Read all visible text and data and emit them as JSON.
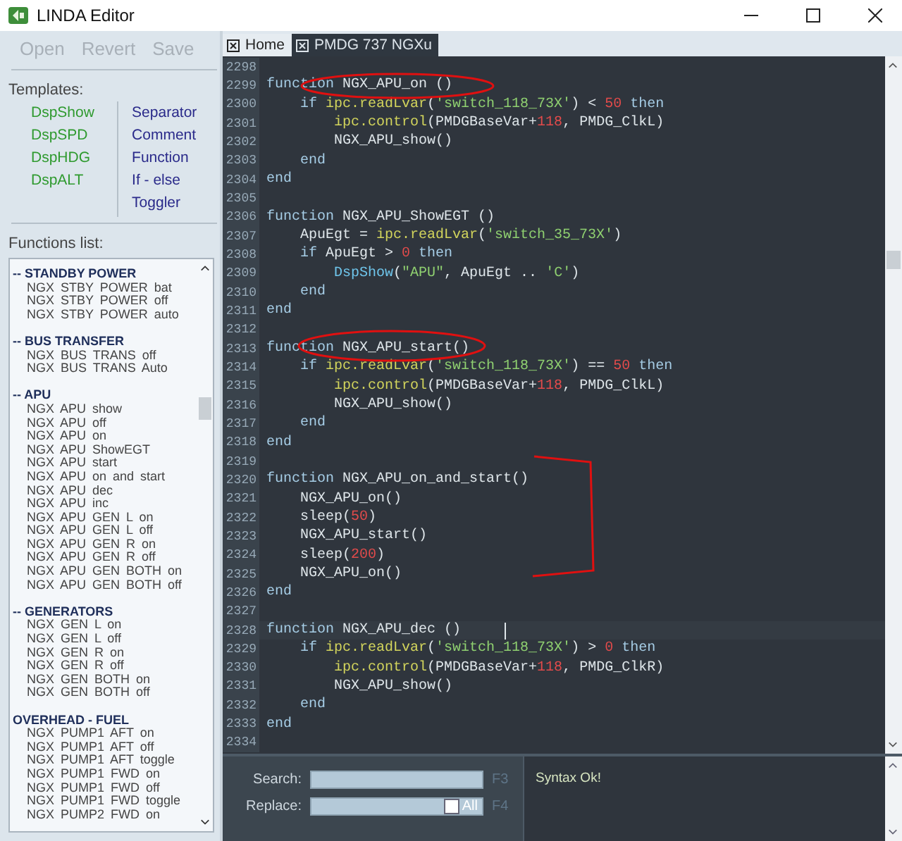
{
  "window": {
    "title": "LINDA Editor"
  },
  "toolbar": [
    {
      "label": "Open",
      "disabled": true
    },
    {
      "label": "Revert",
      "disabled": true
    },
    {
      "label": "Save",
      "disabled": true
    }
  ],
  "templates": {
    "label": "Templates:",
    "columns": [
      {
        "kind": "display",
        "items": [
          "DspShow",
          "DspSPD",
          "DspHDG",
          "DspALT"
        ]
      },
      {
        "kind": "structure",
        "items": [
          "Separator",
          "Comment",
          "Function",
          "If - else",
          "Toggler"
        ]
      }
    ]
  },
  "functions_list": {
    "label": "Functions list:",
    "groups": [
      {
        "title": "-- STANDBY POWER",
        "items": [
          "NGX STBY POWER bat",
          "NGX STBY POWER off",
          "NGX STBY POWER auto"
        ]
      },
      {
        "title": "-- BUS TRANSFER",
        "items": [
          "NGX BUS TRANS off",
          "NGX BUS TRANS Auto"
        ]
      },
      {
        "title": "-- APU",
        "items": [
          "NGX APU show",
          "NGX APU off",
          "NGX APU on",
          "NGX APU ShowEGT",
          "NGX APU start",
          "NGX APU on and start",
          "NGX APU dec",
          "NGX APU inc",
          "NGX APU GEN L on",
          "NGX APU GEN L off",
          "NGX APU GEN R on",
          "NGX APU GEN R off",
          "NGX APU GEN BOTH on",
          "NGX APU GEN BOTH off"
        ]
      },
      {
        "title": "-- GENERATORS",
        "items": [
          "NGX GEN L on",
          "NGX GEN L off",
          "NGX GEN R on",
          "NGX GEN R off",
          "NGX GEN BOTH on",
          "NGX GEN BOTH off"
        ]
      },
      {
        "title": "OVERHEAD - FUEL",
        "items": [
          "NGX PUMP1 AFT on",
          "NGX PUMP1 AFT off",
          "NGX PUMP1 AFT toggle",
          "NGX PUMP1 FWD on",
          "NGX PUMP1 FWD off",
          "NGX PUMP1 FWD toggle",
          "NGX PUMP2 FWD on"
        ]
      }
    ]
  },
  "tabs": [
    {
      "label": "Home",
      "selected": false
    },
    {
      "label": "PMDG 737 NGXu",
      "selected": true
    }
  ],
  "editor": {
    "lines": [
      {
        "number": "2298",
        "current": false
      },
      {
        "number": "2299",
        "current": false,
        "tokens": [
          {
            "kind": "keyword",
            "text": "function"
          },
          {
            "kind": "plain",
            "text": " NGX_APU_on ()"
          }
        ]
      },
      {
        "number": "2300",
        "current": false,
        "tokens": [
          {
            "kind": "keyword",
            "text": "    if "
          },
          {
            "kind": "library",
            "text": "ipc.readLvar"
          },
          {
            "kind": "plain",
            "text": "("
          },
          {
            "kind": "string",
            "text": "'switch_118_73X'"
          },
          {
            "kind": "plain",
            "text": ") < "
          },
          {
            "kind": "number",
            "text": "50"
          },
          {
            "kind": "keyword",
            "text": " then"
          }
        ]
      },
      {
        "number": "2301",
        "current": false,
        "tokens": [
          {
            "kind": "library",
            "text": "        ipc.control"
          },
          {
            "kind": "plain",
            "text": "(PMDGBaseVar+"
          },
          {
            "kind": "number",
            "text": "118"
          },
          {
            "kind": "plain",
            "text": ", PMDG_ClkL)"
          }
        ]
      },
      {
        "number": "2302",
        "current": false,
        "tokens": [
          {
            "kind": "plain",
            "text": "        NGX_APU_show()"
          }
        ]
      },
      {
        "number": "2303",
        "current": false,
        "tokens": [
          {
            "kind": "keyword",
            "text": "    end"
          }
        ]
      },
      {
        "number": "2304",
        "current": false,
        "tokens": [
          {
            "kind": "keyword",
            "text": "end"
          }
        ]
      },
      {
        "number": "2305",
        "current": false
      },
      {
        "number": "2306",
        "current": false,
        "tokens": [
          {
            "kind": "keyword",
            "text": "function"
          },
          {
            "kind": "plain",
            "text": " NGX_APU_ShowEGT ()"
          }
        ]
      },
      {
        "number": "2307",
        "current": false,
        "tokens": [
          {
            "kind": "plain",
            "text": "    ApuEgt = "
          },
          {
            "kind": "library",
            "text": "ipc.readLvar"
          },
          {
            "kind": "plain",
            "text": "("
          },
          {
            "kind": "string",
            "text": "'switch_35_73X'"
          },
          {
            "kind": "plain",
            "text": ")"
          }
        ]
      },
      {
        "number": "2308",
        "current": false,
        "tokens": [
          {
            "kind": "keyword",
            "text": "    if"
          },
          {
            "kind": "plain",
            "text": " ApuEgt > "
          },
          {
            "kind": "number",
            "text": "0"
          },
          {
            "kind": "keyword",
            "text": " then"
          }
        ]
      },
      {
        "number": "2309",
        "current": false,
        "tokens": [
          {
            "kind": "call",
            "text": "        DspShow"
          },
          {
            "kind": "plain",
            "text": "("
          },
          {
            "kind": "string",
            "text": "\"APU\""
          },
          {
            "kind": "plain",
            "text": ", ApuEgt .. "
          },
          {
            "kind": "string",
            "text": "'C'"
          },
          {
            "kind": "plain",
            "text": ")"
          }
        ]
      },
      {
        "number": "2310",
        "current": false,
        "tokens": [
          {
            "kind": "keyword",
            "text": "    end"
          }
        ]
      },
      {
        "number": "2311",
        "current": false,
        "tokens": [
          {
            "kind": "keyword",
            "text": "end"
          }
        ]
      },
      {
        "number": "2312",
        "current": false
      },
      {
        "number": "2313",
        "current": false,
        "tokens": [
          {
            "kind": "keyword",
            "text": "function"
          },
          {
            "kind": "plain",
            "text": " NGX_APU_start()"
          }
        ]
      },
      {
        "number": "2314",
        "current": false,
        "tokens": [
          {
            "kind": "keyword",
            "text": "    if "
          },
          {
            "kind": "library",
            "text": "ipc.readLvar"
          },
          {
            "kind": "plain",
            "text": "("
          },
          {
            "kind": "string",
            "text": "'switch_118_73X'"
          },
          {
            "kind": "plain",
            "text": ") == "
          },
          {
            "kind": "number",
            "text": "50"
          },
          {
            "kind": "keyword",
            "text": " then"
          }
        ]
      },
      {
        "number": "2315",
        "current": false,
        "tokens": [
          {
            "kind": "library",
            "text": "        ipc.control"
          },
          {
            "kind": "plain",
            "text": "(PMDGBaseVar+"
          },
          {
            "kind": "number",
            "text": "118"
          },
          {
            "kind": "plain",
            "text": ", PMDG_ClkL)"
          }
        ]
      },
      {
        "number": "2316",
        "current": false,
        "tokens": [
          {
            "kind": "plain",
            "text": "        NGX_APU_show()"
          }
        ]
      },
      {
        "number": "2317",
        "current": false,
        "tokens": [
          {
            "kind": "keyword",
            "text": "    end"
          }
        ]
      },
      {
        "number": "2318",
        "current": false,
        "tokens": [
          {
            "kind": "keyword",
            "text": "end"
          }
        ]
      },
      {
        "number": "2319",
        "current": false
      },
      {
        "number": "2320",
        "current": false,
        "tokens": [
          {
            "kind": "keyword",
            "text": "function"
          },
          {
            "kind": "plain",
            "text": " NGX_APU_on_and_start()"
          }
        ]
      },
      {
        "number": "2321",
        "current": false,
        "tokens": [
          {
            "kind": "plain",
            "text": "    NGX_APU_on()"
          }
        ]
      },
      {
        "number": "2322",
        "current": false,
        "tokens": [
          {
            "kind": "plain",
            "text": "    sleep("
          },
          {
            "kind": "number",
            "text": "50"
          },
          {
            "kind": "plain",
            "text": ")"
          }
        ]
      },
      {
        "number": "2323",
        "current": false,
        "tokens": [
          {
            "kind": "plain",
            "text": "    NGX_APU_start()"
          }
        ]
      },
      {
        "number": "2324",
        "current": false,
        "tokens": [
          {
            "kind": "plain",
            "text": "    sleep("
          },
          {
            "kind": "number",
            "text": "200"
          },
          {
            "kind": "plain",
            "text": ")"
          }
        ]
      },
      {
        "number": "2325",
        "current": false,
        "tokens": [
          {
            "kind": "plain",
            "text": "    NGX_APU_on()"
          }
        ]
      },
      {
        "number": "2326",
        "current": false,
        "tokens": [
          {
            "kind": "keyword",
            "text": "end"
          }
        ]
      },
      {
        "number": "2327",
        "current": false
      },
      {
        "number": "2328",
        "current": true,
        "tokens": [
          {
            "kind": "keyword",
            "text": "function"
          },
          {
            "kind": "plain",
            "text": " NGX_APU_dec ()"
          }
        ]
      },
      {
        "number": "2329",
        "current": false,
        "tokens": [
          {
            "kind": "keyword",
            "text": "    if "
          },
          {
            "kind": "library",
            "text": "ipc.readLvar"
          },
          {
            "kind": "plain",
            "text": "("
          },
          {
            "kind": "string",
            "text": "'switch_118_73X'"
          },
          {
            "kind": "plain",
            "text": ") > "
          },
          {
            "kind": "number",
            "text": "0"
          },
          {
            "kind": "keyword",
            "text": " then"
          }
        ]
      },
      {
        "number": "2330",
        "current": false,
        "tokens": [
          {
            "kind": "library",
            "text": "        ipc.control"
          },
          {
            "kind": "plain",
            "text": "(PMDGBaseVar+"
          },
          {
            "kind": "number",
            "text": "118"
          },
          {
            "kind": "plain",
            "text": ", PMDG_ClkR)"
          }
        ]
      },
      {
        "number": "2331",
        "current": false,
        "tokens": [
          {
            "kind": "plain",
            "text": "        NGX_APU_show()"
          }
        ]
      },
      {
        "number": "2332",
        "current": false,
        "tokens": [
          {
            "kind": "keyword",
            "text": "    end"
          }
        ]
      },
      {
        "number": "2333",
        "current": false,
        "tokens": [
          {
            "kind": "keyword",
            "text": "end"
          }
        ]
      },
      {
        "number": "2334",
        "current": false
      }
    ]
  },
  "search_panel": {
    "search_label": "Search:",
    "search_key": "F3",
    "replace_label": "Replace:",
    "replace_key": "F4",
    "all_label": "All",
    "all_checked": false
  },
  "output": {
    "message": "Syntax Ok!"
  }
}
